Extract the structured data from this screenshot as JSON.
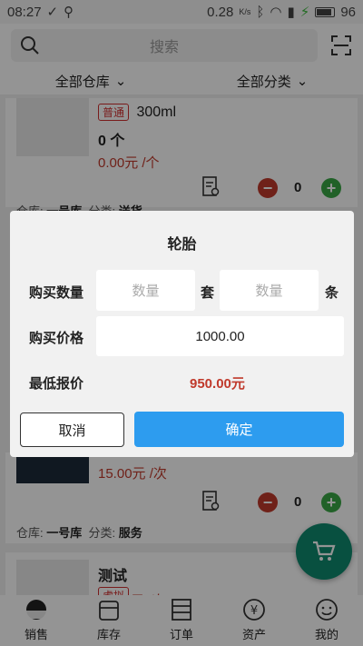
{
  "status_bar": {
    "time": "08:27",
    "network_speed": "0.28",
    "speed_unit": "K/s",
    "battery": "96"
  },
  "search": {
    "placeholder": "搜索"
  },
  "filters": {
    "warehouse": "全部仓库",
    "category": "全部分类"
  },
  "products": [
    {
      "tag": "普通",
      "name": "300ml",
      "qty": "0 个",
      "price": "0.00元 /个",
      "count": "0",
      "warehouse_label": "仓库:",
      "warehouse": "一号库",
      "category_label": "分类:",
      "category": "送货"
    },
    {
      "price": "15.00元 /次",
      "count": "0",
      "warehouse_label": "仓库:",
      "warehouse": "一号库",
      "category_label": "分类:",
      "category": "服务"
    },
    {
      "name": "测试",
      "tag": "虚拟",
      "price": "元 /次"
    }
  ],
  "dialog": {
    "title": "轮胎",
    "qty_label": "购买数量",
    "qty_placeholder_1": "数量",
    "unit_1": "套",
    "qty_placeholder_2": "数量",
    "unit_2": "条",
    "price_label": "购买价格",
    "price_value": "1000.00",
    "min_price_label": "最低报价",
    "min_price_value": "950.00元",
    "cancel": "取消",
    "confirm": "确定"
  },
  "bottom_nav": [
    {
      "label": "销售",
      "icon": "sales-icon"
    },
    {
      "label": "库存",
      "icon": "inventory-icon"
    },
    {
      "label": "订单",
      "icon": "orders-icon"
    },
    {
      "label": "资产",
      "icon": "assets-icon"
    },
    {
      "label": "我的",
      "icon": "profile-icon"
    }
  ],
  "colors": {
    "accent": "#2d9cef",
    "price": "#c0392b",
    "plus": "#39a845",
    "fab": "#0f8a6e"
  }
}
